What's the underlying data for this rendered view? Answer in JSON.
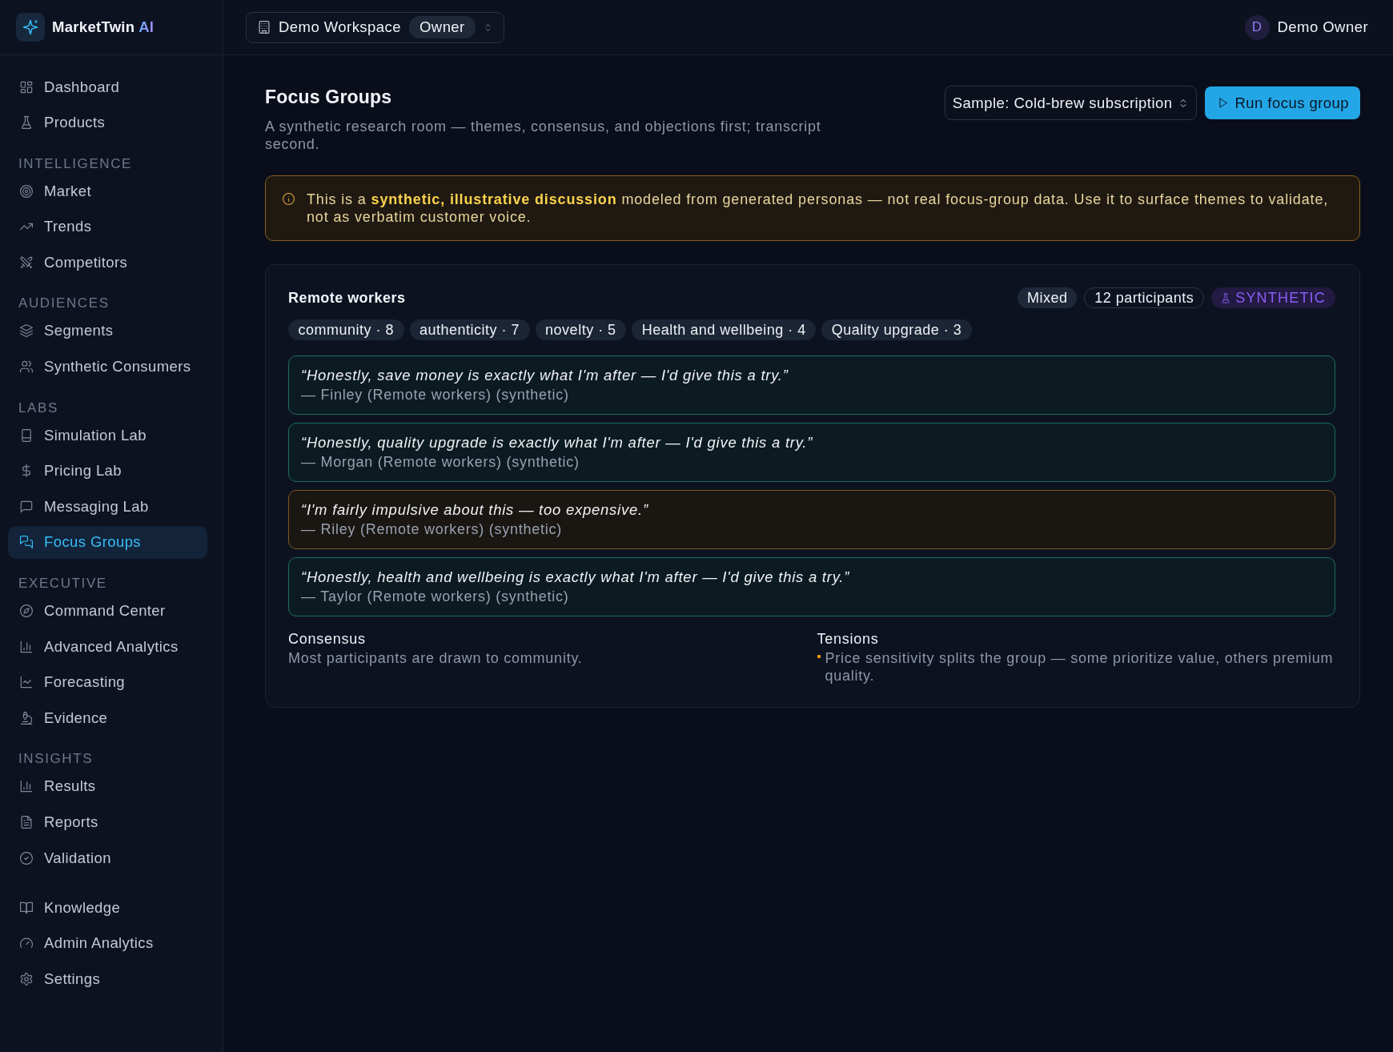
{
  "brand": {
    "name": "MarketTwin",
    "accent": "AI"
  },
  "sidebar": {
    "groups": [
      {
        "items": [
          {
            "label": "Dashboard",
            "selected": false
          },
          {
            "label": "Products",
            "selected": false
          }
        ]
      },
      {
        "heading": "INTELLIGENCE",
        "items": [
          {
            "label": "Market",
            "selected": false
          },
          {
            "label": "Trends",
            "selected": false
          },
          {
            "label": "Competitors",
            "selected": false
          }
        ]
      },
      {
        "heading": "AUDIENCES",
        "items": [
          {
            "label": "Segments",
            "selected": false
          },
          {
            "label": "Synthetic Consumers",
            "selected": false
          }
        ]
      },
      {
        "heading": "LABS",
        "items": [
          {
            "label": "Simulation Lab",
            "selected": false
          },
          {
            "label": "Pricing Lab",
            "selected": false
          },
          {
            "label": "Messaging Lab",
            "selected": false
          },
          {
            "label": "Focus Groups",
            "selected": true
          }
        ]
      },
      {
        "heading": "EXECUTIVE",
        "items": [
          {
            "label": "Command Center",
            "selected": false
          },
          {
            "label": "Advanced Analytics",
            "selected": false
          },
          {
            "label": "Forecasting",
            "selected": false
          },
          {
            "label": "Evidence",
            "selected": false
          }
        ]
      },
      {
        "heading": "INSIGHTS",
        "items": [
          {
            "label": "Results",
            "selected": false
          },
          {
            "label": "Reports",
            "selected": false
          },
          {
            "label": "Validation",
            "selected": false
          }
        ]
      },
      {
        "items": [
          {
            "label": "Knowledge",
            "selected": false
          },
          {
            "label": "Admin Analytics",
            "selected": false
          },
          {
            "label": "Settings",
            "selected": false
          }
        ]
      }
    ]
  },
  "header": {
    "workspace": "Demo Workspace",
    "role": "Owner",
    "user": {
      "initial": "D",
      "name": "Demo Owner"
    }
  },
  "page": {
    "title": "Focus Groups",
    "subtitle": "A synthetic research room — themes, consensus, and objections first; transcript second.",
    "sample_select": {
      "value": "Sample: Cold-brew subscription"
    },
    "run_button": "Run focus group"
  },
  "notice": {
    "text": "This is a **synthetic, illustrative discussion** modeled from generated personas — not real focus-group data. Use it to surface themes to validate, not as verbatim customer voice."
  },
  "session": {
    "segment": "Remote workers",
    "badges": [
      {
        "text": "Mixed",
        "kind": "filled"
      },
      {
        "text": "12 participants",
        "kind": "outline"
      },
      {
        "text": "SYNTHETIC",
        "kind": "synthetic"
      }
    ],
    "themes": [
      "community · 8",
      "authenticity · 7",
      "novelty · 5",
      "Health and wellbeing · 4",
      "Quality upgrade · 3"
    ],
    "quotes": [
      {
        "text": "“Honestly, save money is exactly what I'm after — I'd give this a try.”",
        "attribution": "— Finley (Remote workers) (synthetic)",
        "kind": "positive"
      },
      {
        "text": "“Honestly, quality upgrade is exactly what I'm after — I'd give this a try.”",
        "attribution": "— Morgan (Remote workers) (synthetic)",
        "kind": "positive"
      },
      {
        "text": "“I'm fairly impulsive about this — too expensive.”",
        "attribution": "— Riley (Remote workers) (synthetic)",
        "kind": "negative"
      },
      {
        "text": "“Honestly, health and wellbeing is exactly what I'm after — I'd give this a try.”",
        "attribution": "— Taylor (Remote workers) (synthetic)",
        "kind": "positive"
      }
    ],
    "consensus": {
      "heading": "Consensus",
      "text": "Most participants are drawn to community."
    },
    "tensions": {
      "heading": "Tensions",
      "items": [
        "Price sensitivity splits the group — some prioritize value, others premium quality."
      ]
    }
  }
}
